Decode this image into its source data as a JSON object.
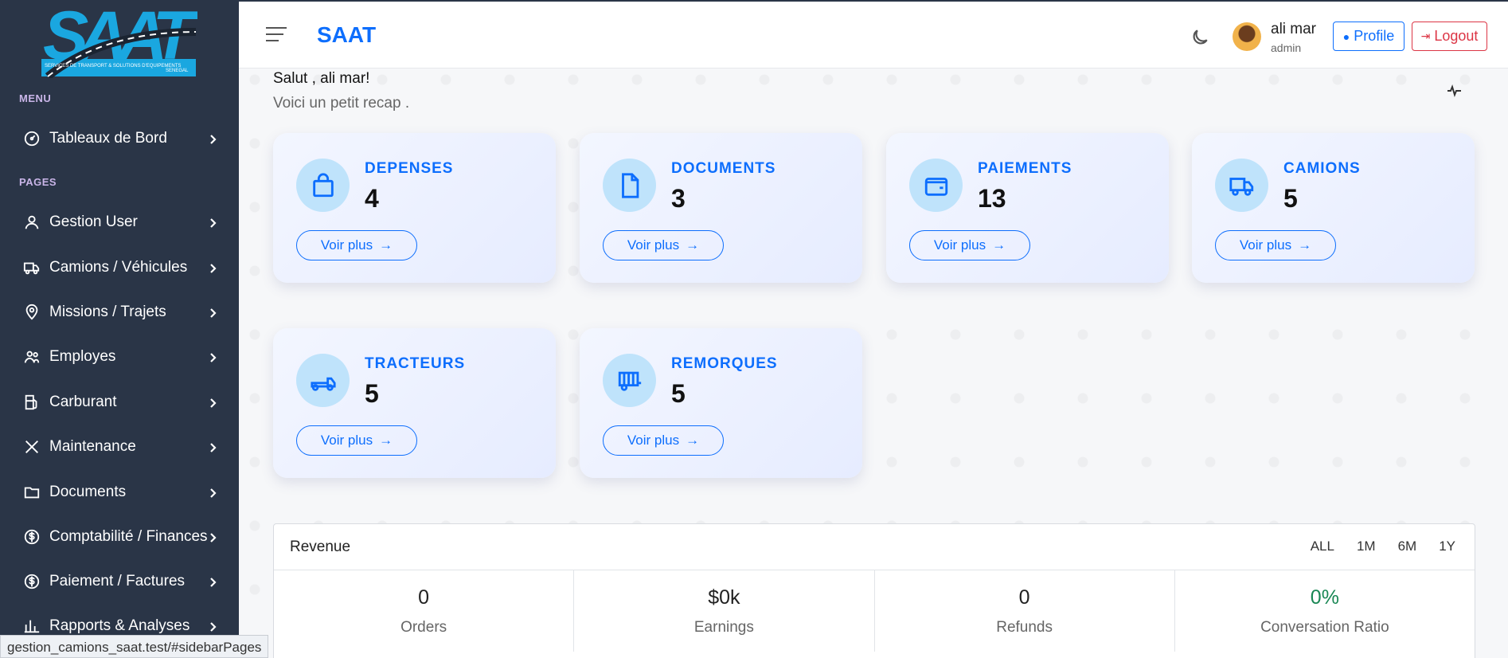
{
  "sidebar": {
    "logo": {
      "text": "SAAT",
      "tagline": "SERVICES DE TRANSPORT & SOLUTIONS D'EQUIPEMENTS",
      "country": "SENEGAL"
    },
    "menu_title": "MENU",
    "pages_title": "PAGES",
    "items": [
      {
        "label": "Tableaux de Bord",
        "icon": "gauge-icon"
      },
      {
        "label": "Gestion User",
        "icon": "user-icon"
      },
      {
        "label": "Camions / Véhicules",
        "icon": "truck-icon"
      },
      {
        "label": "Missions / Trajets",
        "icon": "map-pin-icon"
      },
      {
        "label": "Employes",
        "icon": "users-icon"
      },
      {
        "label": "Carburant",
        "icon": "fuel-icon"
      },
      {
        "label": "Maintenance",
        "icon": "tools-icon"
      },
      {
        "label": "Documents",
        "icon": "folder-icon"
      },
      {
        "label": "Comptabilité / Finances",
        "icon": "dollar-circle-icon"
      },
      {
        "label": "Paiement / Factures",
        "icon": "dollar-circle-icon"
      },
      {
        "label": "Rapports & Analyses",
        "icon": "bar-chart-icon"
      }
    ]
  },
  "header": {
    "brand": "SAAT",
    "user": {
      "name": "ali mar",
      "role": "admin"
    },
    "profile_label": "Profile",
    "logout_label": "Logout"
  },
  "greeting": {
    "hello": "Salut , ali mar!",
    "subtitle": "Voici un petit recap ."
  },
  "cards": [
    {
      "title": "DEPENSES",
      "value": "4",
      "icon": "shopping-bag-icon",
      "button": "Voir plus"
    },
    {
      "title": "DOCUMENTS",
      "value": "3",
      "icon": "file-icon",
      "button": "Voir plus"
    },
    {
      "title": "PAIEMENTS",
      "value": "13",
      "icon": "wallet-icon",
      "button": "Voir plus"
    },
    {
      "title": "CAMIONS",
      "value": "5",
      "icon": "truck-icon",
      "button": "Voir plus"
    },
    {
      "title": "TRACTEURS",
      "value": "5",
      "icon": "tractor-truck-icon",
      "button": "Voir plus"
    },
    {
      "title": "REMORQUES",
      "value": "5",
      "icon": "trailer-icon",
      "button": "Voir plus"
    }
  ],
  "revenue": {
    "title": "Revenue",
    "tabs": [
      "ALL",
      "1M",
      "6M",
      "1Y"
    ],
    "stats": [
      {
        "value": "0",
        "label": "Orders"
      },
      {
        "value": "$0k",
        "label": "Earnings"
      },
      {
        "value": "0",
        "label": "Refunds"
      },
      {
        "value": "0%",
        "label": "Conversation Ratio",
        "color": "#198754"
      }
    ]
  },
  "status_url": "gestion_camions_saat.test/#sidebarPages",
  "colors": {
    "primary": "#0d6efd",
    "danger": "#dc3545",
    "sidebar": "#2a3547",
    "success": "#198754"
  }
}
